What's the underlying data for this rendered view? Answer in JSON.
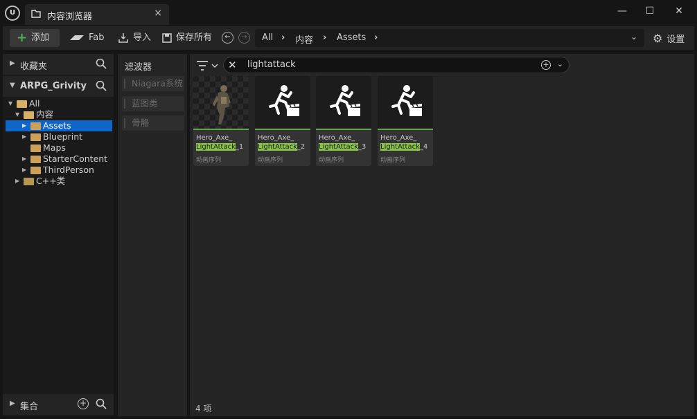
{
  "window": {
    "tab_title": "内容浏览器",
    "close": "×",
    "minimize": "—",
    "maximize": "☐",
    "win_close": "✕"
  },
  "toolbar": {
    "add_label": "添加",
    "fab_label": "Fab",
    "import_label": "导入",
    "save_all_label": "保存所有",
    "settings_label": "设置"
  },
  "breadcrumb": {
    "items": [
      "All",
      "内容",
      "Assets"
    ]
  },
  "sidebar": {
    "favorites_label": "收藏夹",
    "project_label": "ARPG_Grivity",
    "collections_label": "集合",
    "tree": [
      {
        "label": "All",
        "depth": 0,
        "expanded": true,
        "selected": false
      },
      {
        "label": "内容",
        "depth": 1,
        "expanded": true,
        "selected": false
      },
      {
        "label": "Assets",
        "depth": 2,
        "expanded": false,
        "selected": true
      },
      {
        "label": "Blueprint",
        "depth": 2,
        "expanded": false,
        "selected": false
      },
      {
        "label": "Maps",
        "depth": 2,
        "expanded": null,
        "selected": false
      },
      {
        "label": "StarterContent",
        "depth": 2,
        "expanded": false,
        "selected": false
      },
      {
        "label": "ThirdPerson",
        "depth": 2,
        "expanded": false,
        "selected": false
      },
      {
        "label": "C++类",
        "depth": 1,
        "expanded": false,
        "selected": false
      }
    ]
  },
  "filters": {
    "title": "滤波器",
    "items": [
      "Niagara系统",
      "蓝图类",
      "骨骼"
    ]
  },
  "search": {
    "value": "lightattack"
  },
  "assets": [
    {
      "name_prefix": "Hero_Axe_",
      "match": "LightAttack",
      "suffix": "_1",
      "type": "动画序列",
      "thumb": "character-pose"
    },
    {
      "name_prefix": "Hero_Axe_",
      "match": "LightAttack",
      "suffix": "_2",
      "type": "动画序列",
      "thumb": "anim-sequence-icon"
    },
    {
      "name_prefix": "Hero_Axe_",
      "match": "LightAttack",
      "suffix": "_3",
      "type": "动画序列",
      "thumb": "anim-sequence-icon"
    },
    {
      "name_prefix": "Hero_Axe_",
      "match": "LightAttack",
      "suffix": "_4",
      "type": "动画序列",
      "thumb": "anim-sequence-icon"
    }
  ],
  "status": {
    "count": "4 项"
  },
  "colors": {
    "accent_green": "#8bc34a",
    "selection_blue": "#0e66c8",
    "folder": "#c9a15b"
  }
}
